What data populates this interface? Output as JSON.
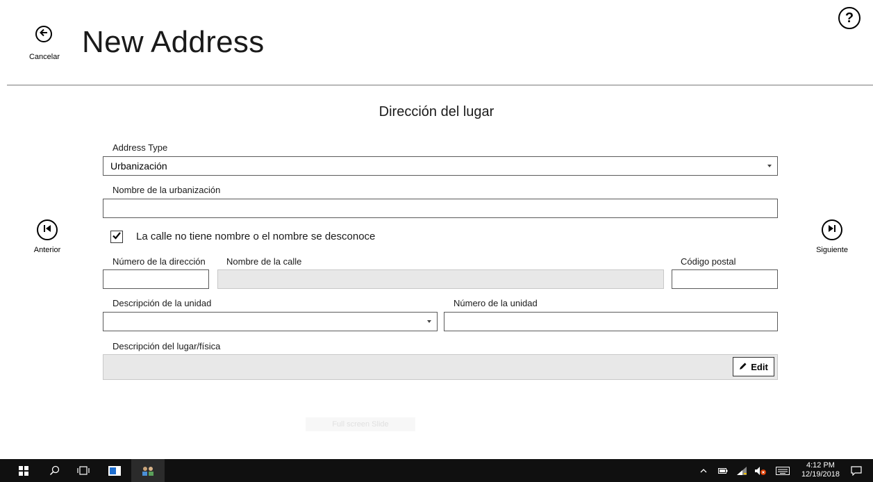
{
  "header": {
    "title": "New Address",
    "cancel_label": "Cancelar",
    "cancel_icon": "arrow-left-icon",
    "help_icon": "question-icon",
    "help_glyph": "?"
  },
  "nav": {
    "previous_label": "Anterior",
    "next_label": "Siguiente"
  },
  "form": {
    "section_title": "Dirección del lugar",
    "address_type": {
      "label": "Address Type",
      "value": "Urbanización"
    },
    "urbanization_name": {
      "label": "Nombre de la urbanización",
      "value": ""
    },
    "no_street_name": {
      "label": "La calle no tiene nombre o el nombre se desconoce",
      "checked": true
    },
    "address_number": {
      "label": "Número de la dirección",
      "value": ""
    },
    "street_name": {
      "label": "Nombre de la calle",
      "value": ""
    },
    "postal_code": {
      "label": "Código postal",
      "value": ""
    },
    "unit_description": {
      "label": "Descripción de la unidad",
      "value": ""
    },
    "unit_number": {
      "label": "Número de la unidad",
      "value": ""
    },
    "place_description": {
      "label": "Descripción del lugar/física",
      "value": "",
      "edit_label": "Edit"
    },
    "footer_button_label": "Full screen Slide"
  },
  "taskbar": {
    "time": "4:12 PM",
    "date": "12/19/2018"
  }
}
